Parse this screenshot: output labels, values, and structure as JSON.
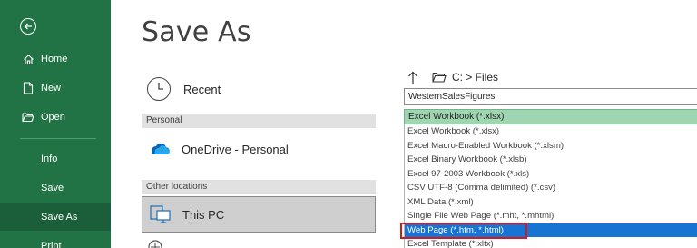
{
  "nav": {
    "back_icon": "back-arrow-circle-icon",
    "items": [
      {
        "label": "Home",
        "icon": "home-icon"
      },
      {
        "label": "New",
        "icon": "new-document-icon"
      },
      {
        "label": "Open",
        "icon": "open-folder-icon"
      },
      {
        "label": "Info"
      },
      {
        "label": "Save"
      },
      {
        "label": "Save As"
      },
      {
        "label": "Print"
      }
    ],
    "background": "#217346"
  },
  "title": "Save As",
  "locations": {
    "recent_label": "Recent",
    "personal_header": "Personal",
    "onedrive_label": "OneDrive - Personal",
    "other_header": "Other locations",
    "thispc_label": "This PC"
  },
  "right": {
    "path": "C: > Files",
    "filename_value": "WesternSalesFigures",
    "selected_type": "Excel Workbook (*.xlsx)",
    "type_options": [
      "Excel Workbook (*.xlsx)",
      "Excel Macro-Enabled Workbook (*.xlsm)",
      "Excel Binary Workbook (*.xlsb)",
      "Excel 97-2003 Workbook (*.xls)",
      "CSV UTF-8 (Comma delimited) (*.csv)",
      "XML Data (*.xml)",
      "Single File Web Page (*.mht, *.mhtml)",
      "Web Page (*.htm, *.html)",
      "Excel Template (*.xltx)"
    ],
    "highlighted_option": "Web Page (*.htm, *.html)",
    "accent": "#1874d2",
    "annotation_color": "#d6171c"
  }
}
